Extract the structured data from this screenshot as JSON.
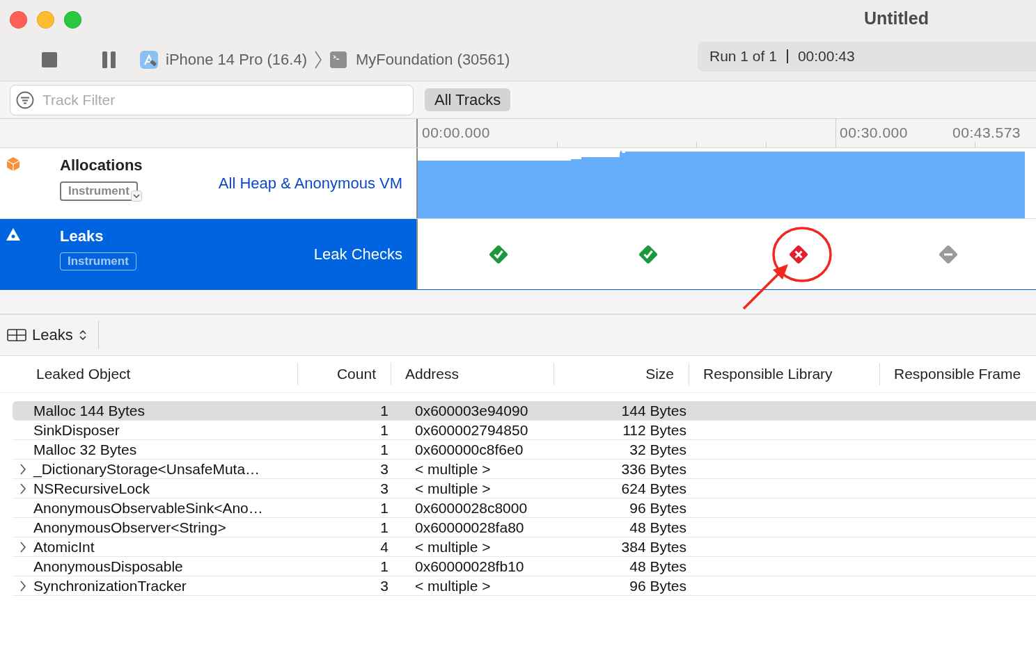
{
  "window": {
    "title": "Untitled"
  },
  "toolbar": {
    "device": "iPhone 14 Pro (16.4)",
    "process": "MyFoundation (30561)",
    "run_status": "Run 1 of 1",
    "elapsed": "00:00:43"
  },
  "filter": {
    "placeholder": "Track Filter",
    "scope_button": "All Tracks"
  },
  "timeline": {
    "tick_labels": [
      {
        "label": "00:00.000",
        "kind": "start"
      },
      {
        "label": "00:30.000",
        "kind": "mid"
      },
      {
        "label": "00:43.573",
        "kind": "end"
      }
    ]
  },
  "tracks": [
    {
      "name": "Allocations",
      "badge": "Instrument",
      "detail": "All Heap & Anonymous VM",
      "selected": false,
      "kind": "graph"
    },
    {
      "name": "Leaks",
      "badge": "Instrument",
      "detail": "Leak Checks",
      "selected": true,
      "kind": "checks"
    }
  ],
  "leak_checks": [
    {
      "kind": "pass"
    },
    {
      "kind": "pass"
    },
    {
      "kind": "fail"
    },
    {
      "kind": "none"
    }
  ],
  "detail_view": {
    "selector": "Leaks"
  },
  "table": {
    "columns": [
      "Leaked Object",
      "Count",
      "Address",
      "Size",
      "Responsible Library",
      "Responsible Frame"
    ],
    "rows": [
      {
        "object": "Malloc 144 Bytes",
        "count": "1",
        "address": "0x600003e94090",
        "size": "144 Bytes",
        "expandable": false,
        "selected": true
      },
      {
        "object": "SinkDisposer",
        "count": "1",
        "address": "0x600002794850",
        "size": "112 Bytes",
        "expandable": false,
        "selected": false
      },
      {
        "object": "Malloc 32 Bytes",
        "count": "1",
        "address": "0x600000c8f6e0",
        "size": "32 Bytes",
        "expandable": false,
        "selected": false
      },
      {
        "object": "_DictionaryStorage<UnsafeMuta…",
        "count": "3",
        "address": "< multiple >",
        "size": "336 Bytes",
        "expandable": true,
        "selected": false
      },
      {
        "object": "NSRecursiveLock",
        "count": "3",
        "address": "< multiple >",
        "size": "624 Bytes",
        "expandable": true,
        "selected": false
      },
      {
        "object": "AnonymousObservableSink<Ano…",
        "count": "1",
        "address": "0x6000028c8000",
        "size": "96 Bytes",
        "expandable": false,
        "selected": false
      },
      {
        "object": "AnonymousObserver<String>",
        "count": "1",
        "address": "0x60000028fa80",
        "size": "48 Bytes",
        "expandable": false,
        "selected": false
      },
      {
        "object": "AtomicInt",
        "count": "4",
        "address": "< multiple >",
        "size": "384 Bytes",
        "expandable": true,
        "selected": false
      },
      {
        "object": "AnonymousDisposable",
        "count": "1",
        "address": "0x60000028fb10",
        "size": "48 Bytes",
        "expandable": false,
        "selected": false
      },
      {
        "object": "SynchronizationTracker",
        "count": "3",
        "address": "< multiple >",
        "size": "96 Bytes",
        "expandable": true,
        "selected": false
      }
    ]
  }
}
